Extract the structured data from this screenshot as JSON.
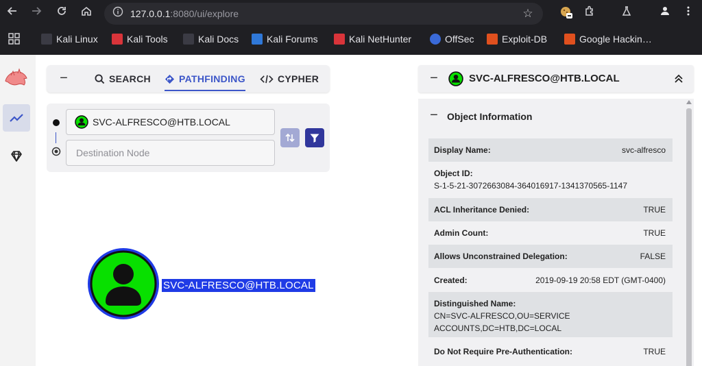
{
  "browser": {
    "url_host": "127.0.0.1",
    "url_rest": ":8080/ui/explore",
    "bookmarks": [
      {
        "label": "Kali Linux",
        "color": "#3b3b44"
      },
      {
        "label": "Kali Tools",
        "color": "#d9343a"
      },
      {
        "label": "Kali Docs",
        "color": "#3b3b44"
      },
      {
        "label": "Kali Forums",
        "color": "#2f78d8"
      },
      {
        "label": "Kali NetHunter",
        "color": "#d9343a"
      },
      {
        "label": "OffSec",
        "color": "#3a6ad8"
      },
      {
        "label": "Exploit-DB",
        "color": "#e0501e"
      },
      {
        "label": "Google Hackin…",
        "color": "#e0501e"
      }
    ]
  },
  "search": {
    "tabs": [
      {
        "label": "SEARCH",
        "active": false
      },
      {
        "label": "PATHFINDING",
        "active": true
      },
      {
        "label": "CYPHER",
        "active": false
      }
    ],
    "source_node": "SVC-ALFRESCO@HTB.LOCAL",
    "destination_placeholder": "Destination Node"
  },
  "graph": {
    "node_label": "SVC-ALFRESCO@HTB.LOCAL",
    "node_color": "#08e000",
    "ring_color": "#1f3be6"
  },
  "details": {
    "title": "SVC-ALFRESCO@HTB.LOCAL",
    "section_title": "Object Information",
    "rows": [
      {
        "key": "Display Name:",
        "value": "svc-alfresco"
      },
      {
        "key": "Object ID:",
        "value": "S-1-5-21-3072663084-364016917-1341370565-1147"
      },
      {
        "key": "ACL Inheritance Denied:",
        "value": "TRUE"
      },
      {
        "key": "Admin Count:",
        "value": "TRUE"
      },
      {
        "key": "Allows Unconstrained Delegation:",
        "value": "FALSE"
      },
      {
        "key": "Created:",
        "value": "2019-09-19 20:58 EDT (GMT-0400)"
      },
      {
        "key": "Distinguished Name:",
        "value_lines": [
          "CN=SVC-ALFRESCO,OU=SERVICE",
          "ACCOUNTS,DC=HTB,DC=LOCAL"
        ]
      },
      {
        "key": "Do Not Require Pre-Authentication:",
        "value": "TRUE"
      }
    ]
  }
}
